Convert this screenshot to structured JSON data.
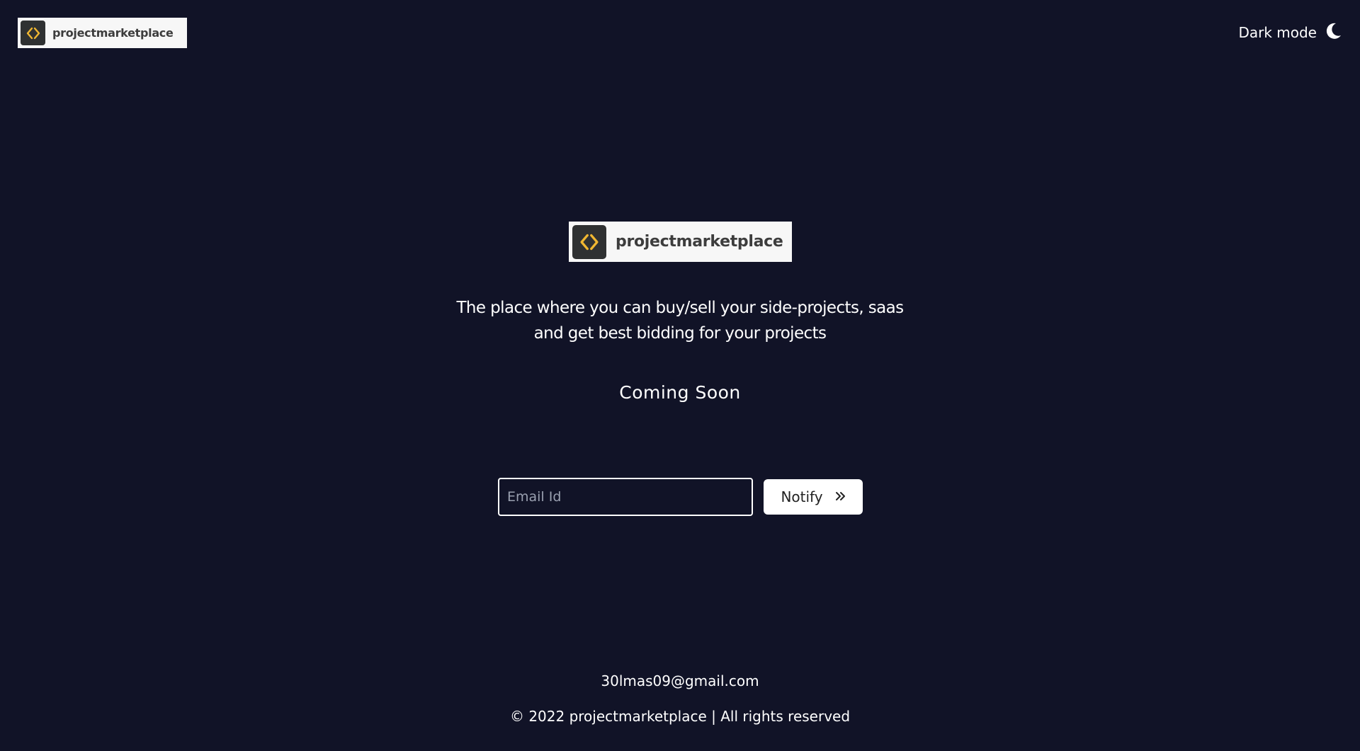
{
  "header": {
    "logo_text": "projectmarketplace",
    "dark_mode_label": "Dark mode"
  },
  "hero": {
    "logo_text": "projectmarketplace",
    "tagline_line1": "The place where you can buy/sell your side-projects, saas",
    "tagline_line2": "and get best bidding for your projects",
    "coming_soon": "Coming Soon"
  },
  "subscribe": {
    "email_placeholder": "Email Id",
    "email_value": "",
    "notify_label": "Notify"
  },
  "footer": {
    "contact_email": "30lmas09@gmail.com",
    "copyright": "© 2022 projectmarketplace | All rights reserved"
  },
  "icons": {
    "logo_mark": "code-brackets-icon",
    "dark_mode": "moon-icon",
    "notify": "double-chevron-right-icon"
  },
  "colors": {
    "background": "#111327",
    "logo_background": "#f7f7f7",
    "logo_mark_background": "#2f3132",
    "logo_mark_accent": "#f0b731",
    "text": "#ffffff",
    "button_background": "#ffffff"
  }
}
